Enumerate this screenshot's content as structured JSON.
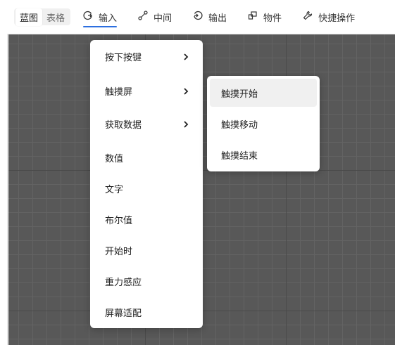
{
  "toolbar": {
    "view_toggle": [
      {
        "label": "蓝图",
        "active": true
      },
      {
        "label": "表格",
        "active": false
      }
    ],
    "tabs": [
      {
        "label": "输入",
        "icon": "input-icon",
        "active": true
      },
      {
        "label": "中间",
        "icon": "link-icon",
        "active": false
      },
      {
        "label": "输出",
        "icon": "output-icon",
        "active": false
      },
      {
        "label": "物件",
        "icon": "objects-icon",
        "active": false
      },
      {
        "label": "快捷操作",
        "icon": "wrench-icon",
        "active": false
      }
    ],
    "accent_color": "#2c6fe0"
  },
  "menu": {
    "items": [
      {
        "label": "按下按键",
        "has_submenu": true
      },
      {
        "label": "触摸屏",
        "has_submenu": true
      },
      {
        "label": "获取数据",
        "has_submenu": true
      },
      {
        "label": "数值",
        "has_submenu": false
      },
      {
        "label": "文字",
        "has_submenu": false
      },
      {
        "label": "布尔值",
        "has_submenu": false
      },
      {
        "label": "开始时",
        "has_submenu": false
      },
      {
        "label": "重力感应",
        "has_submenu": false
      },
      {
        "label": "屏幕适配",
        "has_submenu": false
      }
    ]
  },
  "submenu": {
    "parent": "触摸屏",
    "items": [
      {
        "label": "触摸开始",
        "hovered": true
      },
      {
        "label": "触摸移动",
        "hovered": false
      },
      {
        "label": "触摸结束",
        "hovered": false
      }
    ]
  }
}
